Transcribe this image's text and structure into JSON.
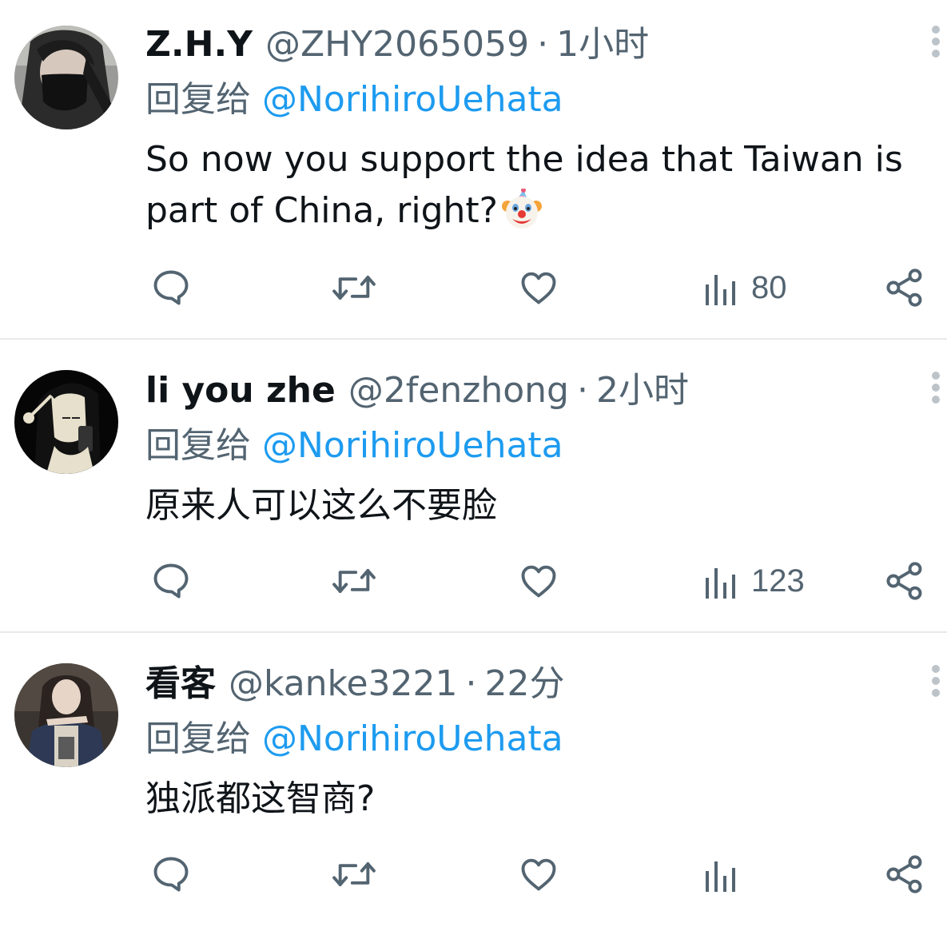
{
  "reply_prefix": "回复给",
  "tweets": [
    {
      "display_name": "Z.H.Y",
      "handle": "@ZHY2065059",
      "time": "1小时",
      "reply_to": "@NorihiroUehata",
      "body": "So now you support the idea that Taiwan is part of China, right?",
      "body_emoji": "clown-face-emoji",
      "views": "80"
    },
    {
      "display_name": "li you zhe",
      "handle": "@2fenzhong",
      "time": "2小时",
      "reply_to": "@NorihiroUehata",
      "body": "原来人可以这么不要脸",
      "views": "123"
    },
    {
      "display_name": "看客",
      "handle": "@kanke3221",
      "time": "22分",
      "reply_to": "@NorihiroUehata",
      "body": "独派都这智商?"
    }
  ],
  "separator": "·",
  "icons": {
    "reply": "speech-bubble-icon",
    "retweet": "retweet-arrows-icon",
    "like": "heart-icon",
    "views": "bar-chart-icon",
    "share": "share-nodes-icon",
    "more": "vertical-dots-icon"
  },
  "colors": {
    "text": "#0f1419",
    "secondary": "#536471",
    "link": "#1d9bf0",
    "divider": "#e7e9ea"
  }
}
